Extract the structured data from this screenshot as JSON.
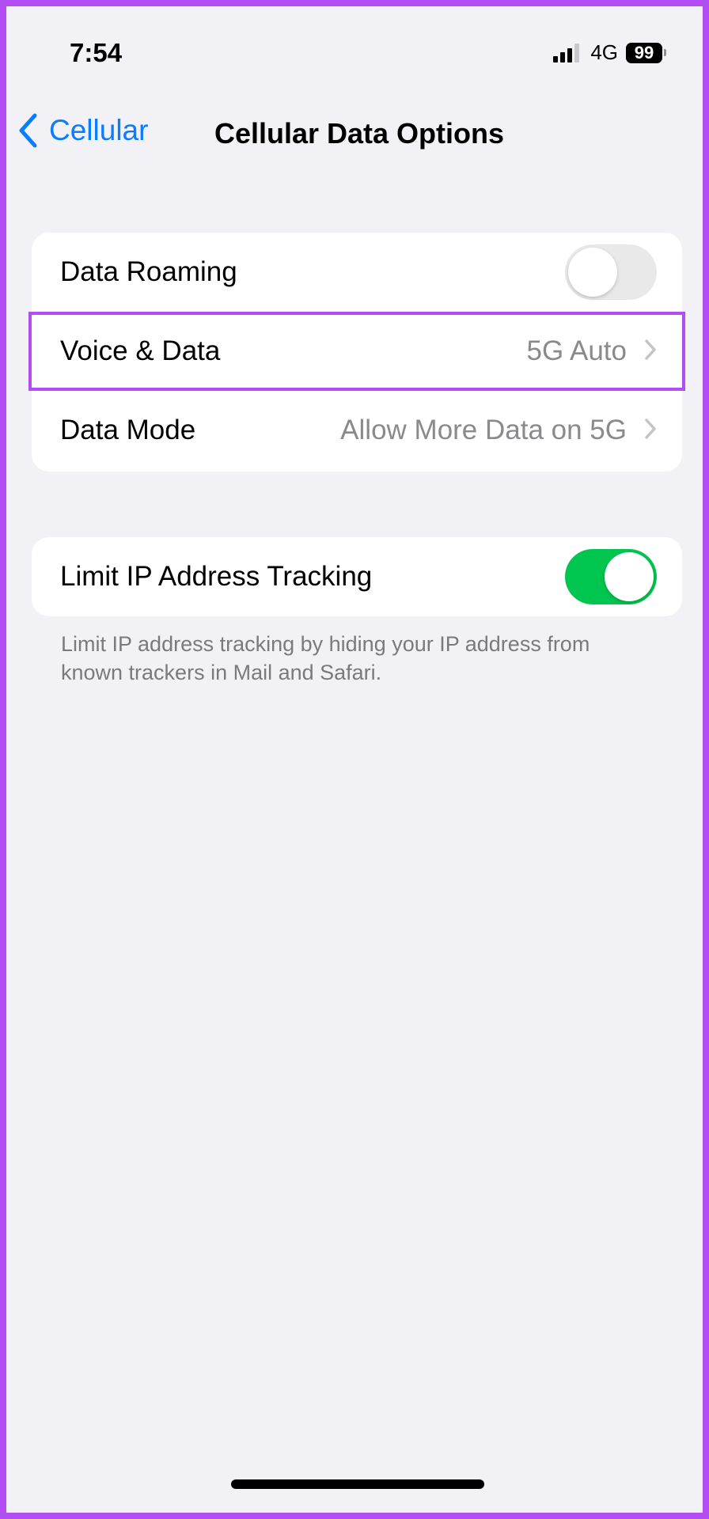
{
  "status_bar": {
    "time": "7:54",
    "network": "4G",
    "battery": "99",
    "signal_icon": "signal-bars-icon",
    "signal_level": 0.75
  },
  "nav": {
    "back_label": "Cellular",
    "back_icon": "chevron-left-icon",
    "title": "Cellular Data Options",
    "accent_color": "#0a7cff"
  },
  "group1": {
    "rows": [
      {
        "label": "Data Roaming",
        "toggle": "off"
      },
      {
        "label": "Voice & Data",
        "value": "5G Auto",
        "highlighted": true
      },
      {
        "label": "Data Mode",
        "value": "Allow More Data on 5G"
      }
    ]
  },
  "group2": {
    "rows": [
      {
        "label": "Limit IP Address Tracking",
        "toggle": "on"
      }
    ],
    "footnote": "Limit IP address tracking by hiding your IP address from known trackers in Mail and Safari."
  },
  "colors": {
    "highlight_border": "#b24df3",
    "toggle_on": "#00c54e",
    "toggle_off": "#e9e9ea",
    "background": "#f2f1f6"
  }
}
